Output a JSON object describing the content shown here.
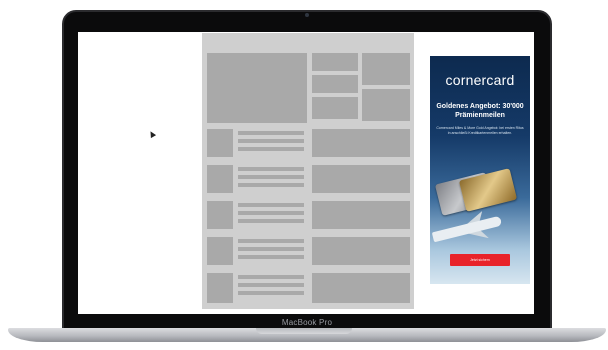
{
  "device": {
    "label": "MacBook Pro"
  },
  "ad": {
    "logo": "cornercard",
    "headline": "Goldenes Angebot: 30'000 Prämienmeilen",
    "body": "Cornercard Miles & More Gold Angebot: bei ersten Ritus in anschließt Kreditkartenmeilen erhalten.",
    "cta_label": "Jetzt sichern",
    "colors": {
      "cta": "#e8232a",
      "background_top": "#0d2a4f"
    }
  },
  "wireframe": {
    "colors": {
      "page": "#cfcfcf",
      "block": "#a9a9a9"
    }
  }
}
